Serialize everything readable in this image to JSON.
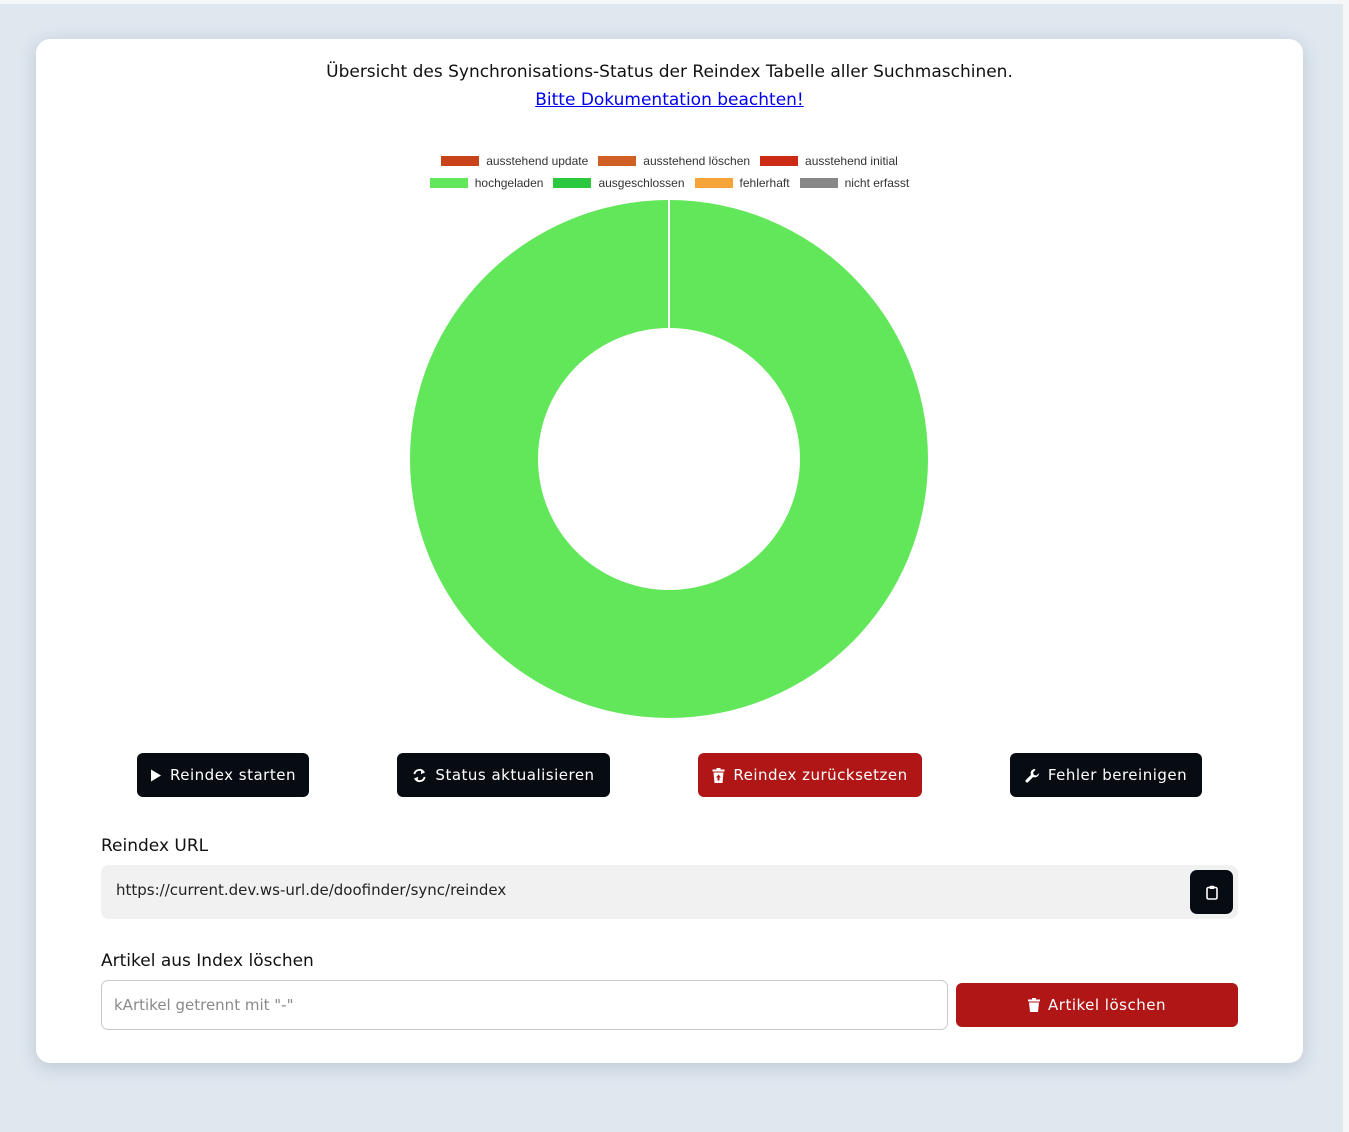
{
  "header": {
    "title": "Übersicht des Synchronisations-Status der Reindex Tabelle aller Suchmaschinen.",
    "doc_link": "Bitte Dokumentation beachten!"
  },
  "legend": {
    "row1": [
      {
        "label": "ausstehend update",
        "color": "#c8421a"
      },
      {
        "label": "ausstehend löschen",
        "color": "#cf5f24"
      },
      {
        "label": "ausstehend initial",
        "color": "#cc2a14"
      }
    ],
    "row2": [
      {
        "label": "hochgeladen",
        "color": "#62e65a"
      },
      {
        "label": "ausgeschlossen",
        "color": "#2bc73e"
      },
      {
        "label": "fehlerhaft",
        "color": "#f6a33a"
      },
      {
        "label": "nicht erfasst",
        "color": "#878787"
      }
    ]
  },
  "chart_data": {
    "type": "pie",
    "variant": "doughnut",
    "categories": [
      "ausstehend update",
      "ausstehend löschen",
      "ausstehend initial",
      "hochgeladen",
      "ausgeschlossen",
      "fehlerhaft",
      "nicht erfasst"
    ],
    "values": [
      0,
      0,
      0,
      100,
      0,
      0,
      0
    ],
    "colors": [
      "#c8421a",
      "#cf5f24",
      "#cc2a14",
      "#62e65a",
      "#2bc73e",
      "#f6a33a",
      "#878787"
    ],
    "legend_position": "top"
  },
  "actions": {
    "start_label": "Reindex starten",
    "refresh_label": "Status aktualisieren",
    "reset_label": "Reindex zurücksetzen",
    "fix_label": "Fehler bereinigen"
  },
  "reindex_url": {
    "label": "Reindex URL",
    "value": "https://current.dev.ws-url.de/doofinder/sync/reindex"
  },
  "delete_articles": {
    "label": "Artikel aus Index löschen",
    "placeholder": "kArtikel getrennt mit \"-\"",
    "button_label": "Artikel löschen"
  }
}
